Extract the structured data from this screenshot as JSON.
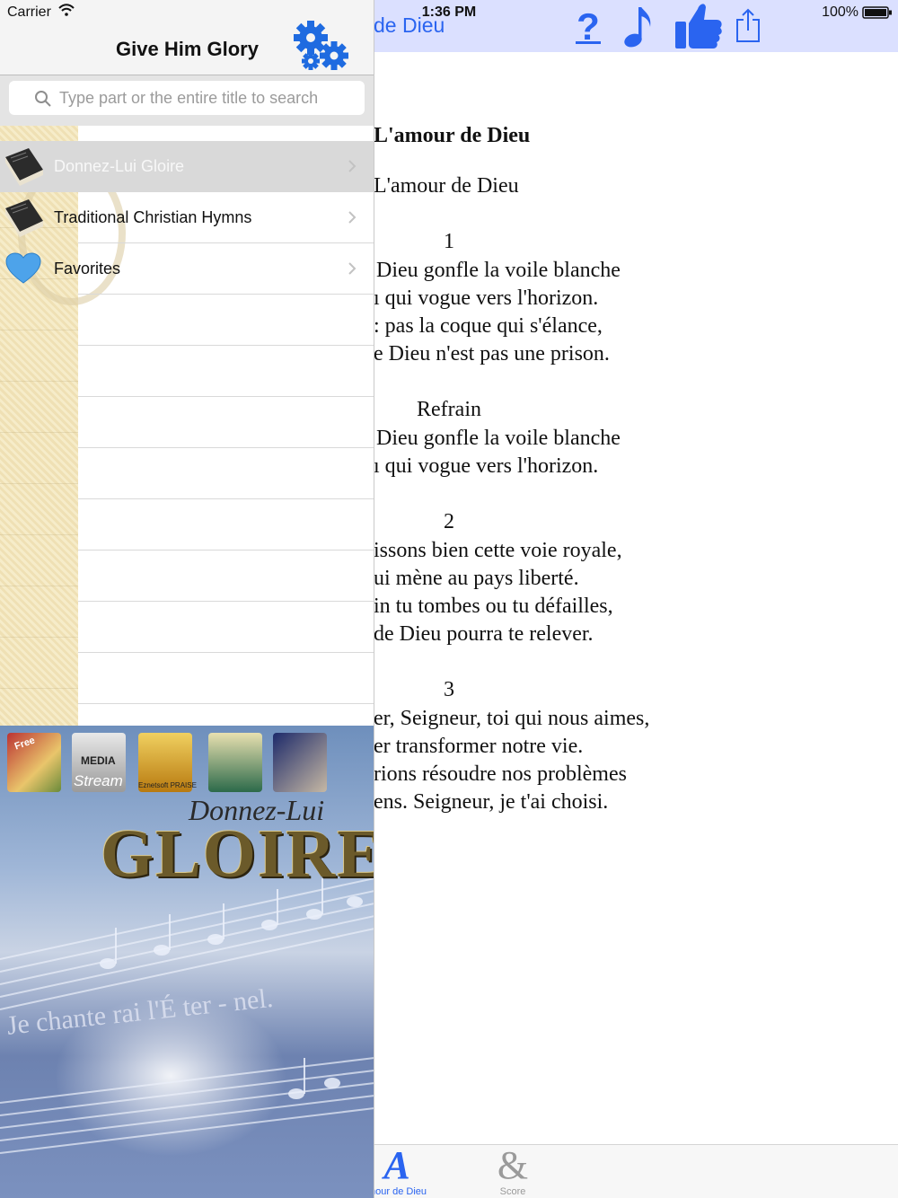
{
  "status_bar": {
    "carrier": "Carrier",
    "time": "1:36 PM",
    "battery": "100%"
  },
  "master": {
    "title": "Give Him Glory",
    "search": {
      "placeholder": "Type part or the entire title to search",
      "value": ""
    },
    "items": [
      {
        "label": "Donnez-Lui Gloire",
        "icon": "book-icon",
        "selected": true
      },
      {
        "label": "Traditional Christian Hymns",
        "icon": "book-icon",
        "selected": false
      },
      {
        "label": "Favorites",
        "icon": "heart-icon",
        "selected": false
      }
    ],
    "banner": {
      "promo_labels": [
        "Free",
        "MEDIA",
        "Stream",
        "Eznetsoft PRAISE"
      ],
      "album_subtitle": "Donnez-Lui",
      "album_title": "GLOIRE",
      "score_lyric": "Je chante rai l'É ter - nel."
    }
  },
  "detail": {
    "nav_title": "de Dieu",
    "toolbar_icons": [
      "help-icon",
      "music-note-icon",
      "thumbs-up-icon",
      "share-icon"
    ],
    "song_title": "L'amour de Dieu",
    "lyrics": {
      "subtitle": "L'amour de Dieu",
      "verse1_number": "1",
      "verse1": [
        "Dieu gonfle la voile blanche",
        "ı qui vogue vers l'horizon.",
        ": pas la coque qui s'élance,",
        "e Dieu n'est pas une prison."
      ],
      "refrain_label": "Refrain",
      "refrain": [
        "Dieu gonfle la voile blanche",
        "ı qui vogue vers l'horizon."
      ],
      "verse2_number": "2",
      "verse2": [
        "issons bien cette voie royale,",
        "ui mène au pays liberté.",
        "in tu tombes ou tu défailles,",
        "de Dieu pourra te relever."
      ],
      "verse3_number": "3",
      "verse3": [
        "er, Seigneur, toi qui nous aimes,",
        "er transformer notre vie.",
        "rions résoudre nos problèmes",
        "ens. Seigneur, je t'ai choisi."
      ]
    },
    "tabs": [
      {
        "glyph": "A",
        "label": "mour de Dieu",
        "active": true
      },
      {
        "glyph": "&",
        "label": "Score",
        "active": false
      }
    ]
  },
  "colors": {
    "accent": "#2a64f0",
    "detail_navbar": "#dbe0ff",
    "selected_row": "#d9d9d9",
    "gear": "#1f6be0"
  }
}
